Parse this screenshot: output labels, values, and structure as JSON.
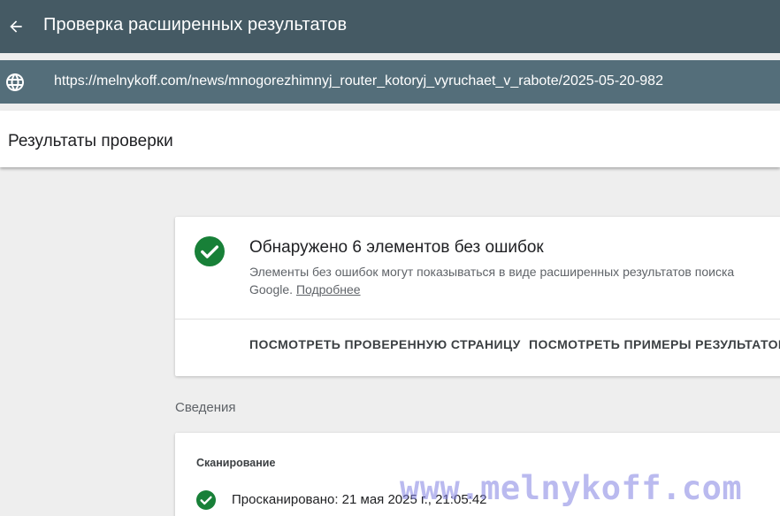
{
  "header": {
    "title": "Проверка расширенных результатов",
    "back_icon": "arrow-left-icon"
  },
  "url_bar": {
    "icon": "globe-icon",
    "url": "https://melnykoff.com/news/mnogorezhimnyj_router_kotoryj_vyruchaet_v_rabote/2025-05-20-982"
  },
  "results": {
    "title": "Результаты проверки"
  },
  "summary_card": {
    "status_icon": "check-circle-icon",
    "status_color": "#188038",
    "title": "Обнаружено 6 элементов без ошибок",
    "description": "Элементы без ошибок могут показываться в виде расширенных результатов поиска Google.",
    "learn_more": "Подробнее",
    "actions": {
      "view_page": "ПОСМОТРЕТЬ ПРОВЕРЕННУЮ СТРАНИЦУ",
      "view_examples": "ПОСМОТРЕТЬ ПРИМЕРЫ РЕЗУЛЬТАТОВ"
    }
  },
  "details": {
    "section_label": "Сведения",
    "crawl": {
      "heading": "Сканирование",
      "status_icon": "check-circle-icon",
      "crawled_text": "Просканировано: 21 мая 2025 г., 21:05:42"
    }
  },
  "watermark": {
    "text": "www.melnykoff.com",
    "color": "#8282e1"
  },
  "colors": {
    "topbar": "#455a64",
    "urlbar": "#546e7a",
    "background": "#eeeeee",
    "success": "#188038"
  }
}
